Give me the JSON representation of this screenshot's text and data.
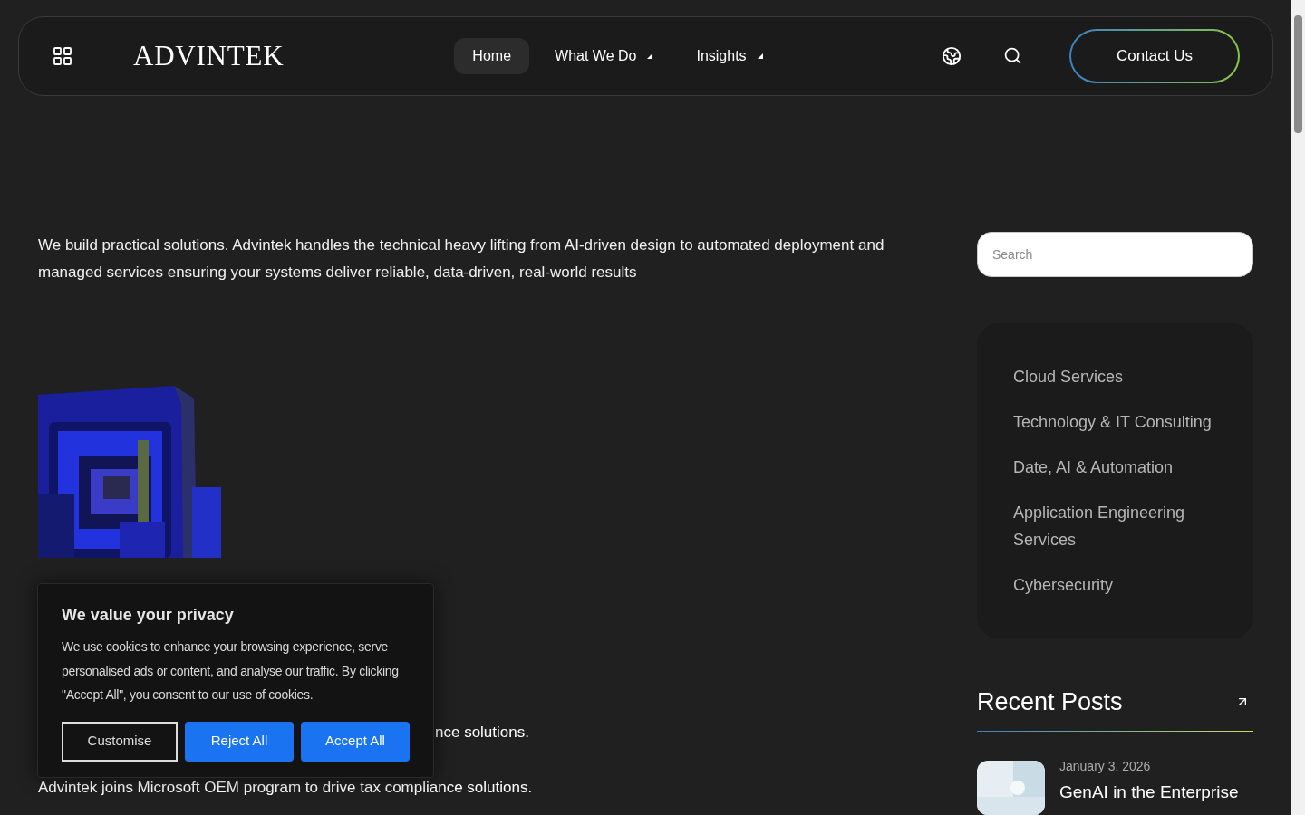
{
  "header": {
    "logo": "ADVINTEK",
    "nav": [
      {
        "label": "Home",
        "selected": true,
        "dropdown": false
      },
      {
        "label": "What We Do",
        "selected": false,
        "dropdown": true
      },
      {
        "label": "Insights",
        "selected": false,
        "dropdown": true
      }
    ],
    "cta": "Contact Us"
  },
  "intro": "We build practical solutions. Advintek handles the technical heavy lifting from AI-driven design to automated deployment and managed services ensuring your systems deliver reliable, data-driven, real-world results",
  "partial_line": "nce solutions.",
  "news_line": "Advintek joins Microsoft OEM program to drive tax compliance solutions.",
  "sidebar": {
    "search": {
      "placeholder": "Search"
    },
    "categories": [
      "Cloud Services",
      "Technology & IT Consulting",
      "Date, AI & Automation",
      "Application Engineering Services",
      "Cybersecurity"
    ],
    "recent_posts": {
      "title": "Recent Posts",
      "posts": [
        {
          "date": "January 3, 2026",
          "title": "GenAI in the Enterprise"
        }
      ]
    }
  },
  "cookie_banner": {
    "title": "We value your privacy",
    "text": "We use cookies to enhance your browsing experience, serve personalised ads or content, and analyse our traffic. By clicking \"Accept All\", you consent to our use of cookies.",
    "buttons": [
      {
        "label": "Customise",
        "kind": "outline"
      },
      {
        "label": "Reject All",
        "kind": "solid"
      },
      {
        "label": "Accept All",
        "kind": "solid"
      }
    ]
  }
}
